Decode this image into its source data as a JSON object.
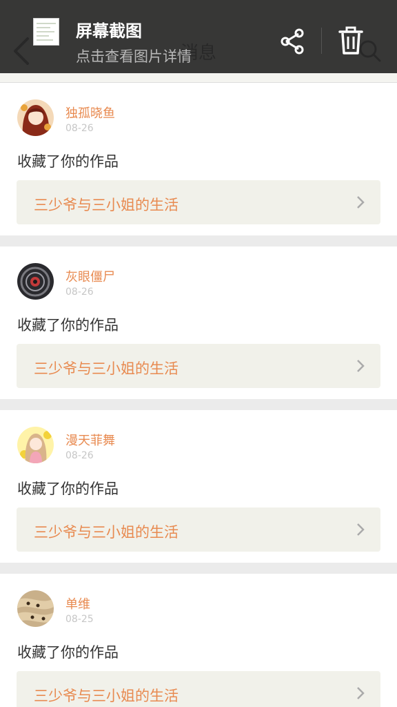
{
  "app": {
    "title": "消息"
  },
  "screenshot_bar": {
    "title": "屏幕截图",
    "subtitle": "点击查看图片详情"
  },
  "messages": [
    {
      "user": "独孤晓鱼",
      "date": "08-26",
      "action": "收藏了你的作品",
      "work": "三少爷与三小姐的生活"
    },
    {
      "user": "灰眼僵尸",
      "date": "08-26",
      "action": "收藏了你的作品",
      "work": "三少爷与三小姐的生活"
    },
    {
      "user": "漫天菲舞",
      "date": "08-26",
      "action": "收藏了你的作品",
      "work": "三少爷与三小姐的生活"
    },
    {
      "user": "单维",
      "date": "08-25",
      "action": "收藏了你的作品",
      "work": "三少爷与三小姐的生活"
    }
  ],
  "colors": {
    "accent": "#e88a50",
    "card_bg": "#ffffff",
    "work_bg": "#f1f1ea",
    "date": "#c6c6c6",
    "overlay": "#282828"
  },
  "icons": {
    "back": "chevron-left-icon",
    "search": "search-icon",
    "share": "share-icon",
    "delete": "trash-icon",
    "chevron": "chevron-right-icon"
  }
}
